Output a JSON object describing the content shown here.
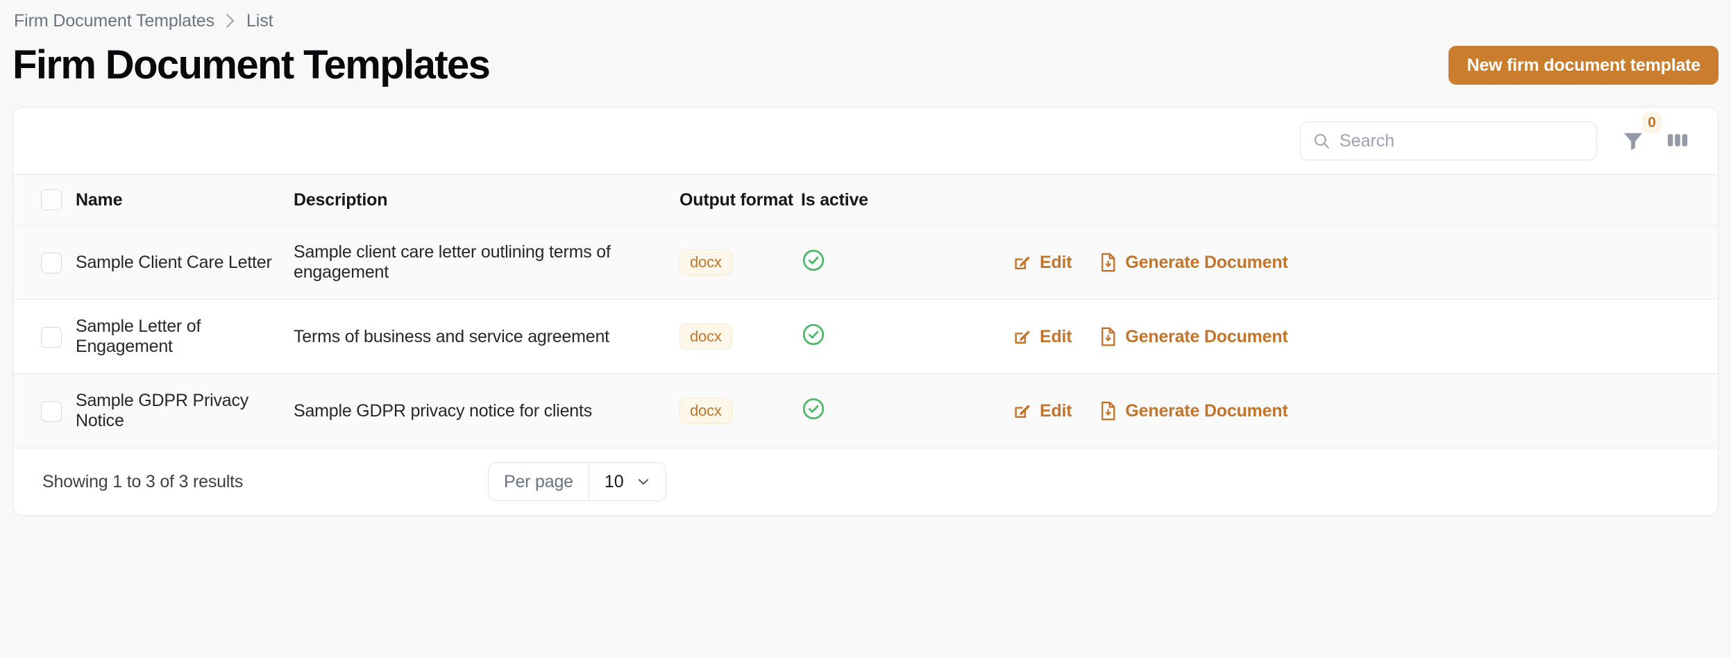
{
  "breadcrumb": {
    "items": [
      {
        "label": "Firm Document Templates"
      },
      {
        "label": "List"
      }
    ],
    "separator_icon": "chevron-right-icon"
  },
  "header": {
    "title": "Firm Document Templates",
    "primary_button": {
      "label": "New firm document template",
      "color": "#ca7d2c",
      "text_color": "#ffffff"
    }
  },
  "toolbar": {
    "search": {
      "placeholder": "Search",
      "value": "",
      "icon": "search-icon"
    },
    "filter": {
      "icon": "filter-funnel-icon",
      "badge_count": "0",
      "badge_bg": "#fdf6e7",
      "badge_color": "#c2752a"
    },
    "columns": {
      "icon": "columns-icon"
    }
  },
  "table": {
    "select_all_checkbox": {
      "checked": false
    },
    "columns": [
      {
        "key": "name",
        "label": "Name"
      },
      {
        "key": "description",
        "label": "Description"
      },
      {
        "key": "output_format",
        "label": "Output format"
      },
      {
        "key": "is_active",
        "label": "Is active"
      },
      {
        "key": "actions",
        "label": ""
      }
    ],
    "rows": [
      {
        "name": "Sample Client Care Letter",
        "description": "Sample client care letter outlining terms of engagement",
        "output_format": "docx",
        "is_active": true,
        "is_active_icon": "check-circle-icon",
        "actions": [
          {
            "label": "Edit",
            "icon": "pencil-square-icon"
          },
          {
            "label": "Generate Document",
            "icon": "document-download-icon"
          }
        ]
      },
      {
        "name": "Sample Letter of Engagement",
        "description": "Terms of business and service agreement",
        "output_format": "docx",
        "is_active": true,
        "is_active_icon": "check-circle-icon",
        "actions": [
          {
            "label": "Edit",
            "icon": "pencil-square-icon"
          },
          {
            "label": "Generate Document",
            "icon": "document-download-icon"
          }
        ]
      },
      {
        "name": "Sample GDPR Privacy Notice",
        "description": "Sample GDPR privacy notice for clients",
        "output_format": "docx",
        "is_active": true,
        "is_active_icon": "check-circle-icon",
        "actions": [
          {
            "label": "Edit",
            "icon": "pencil-square-icon"
          },
          {
            "label": "Generate Document",
            "icon": "document-download-icon"
          }
        ]
      }
    ]
  },
  "footer": {
    "results_text": "Showing 1 to 3 of 3 results",
    "per_page": {
      "label": "Per page",
      "value": "10",
      "chevron_icon": "chevron-down-icon"
    }
  },
  "colors": {
    "accent": "#c2752a",
    "accent_button": "#ca7d2c",
    "active_green": "#4ab862",
    "page_bg": "#f8f8f8",
    "card_bg": "#ffffff",
    "row_alt_bg": "#fafafa",
    "border": "#ececef"
  }
}
